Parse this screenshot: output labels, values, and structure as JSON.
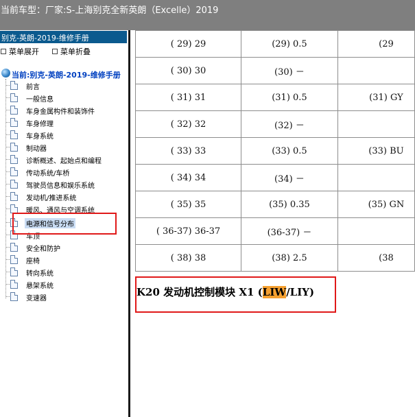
{
  "window": {
    "title": "当前车型：厂家:S-上海别克全新英朗（Excelle）2019"
  },
  "sidebar": {
    "header": "别克-英朗-2019-维修手册",
    "expand_label": "菜单展开",
    "collapse_label": "菜单折叠",
    "root_label": "当前:别克-英朗-2019-维修手册",
    "items": [
      {
        "label": "前言"
      },
      {
        "label": "一般信息"
      },
      {
        "label": "车身金属构件和装饰件"
      },
      {
        "label": "车身修理"
      },
      {
        "label": "车身系统"
      },
      {
        "label": "制动器"
      },
      {
        "label": "诊断概述、起始点和编程"
      },
      {
        "label": "传动系统/车桥"
      },
      {
        "label": "驾驶员信息和娱乐系统"
      },
      {
        "label": "发动机/推进系统"
      },
      {
        "label": "暖风、通风与空调系统"
      },
      {
        "label": "电源和信号分布"
      },
      {
        "label": "车顶"
      },
      {
        "label": "安全和防护"
      },
      {
        "label": "座椅"
      },
      {
        "label": "转向系统"
      },
      {
        "label": "悬架系统"
      },
      {
        "label": "变速器"
      }
    ]
  },
  "table": {
    "rows": [
      [
        "( 29) 29",
        "(29) 0.5",
        "(29"
      ],
      [
        "( 30) 30",
        "(30) －",
        ""
      ],
      [
        "( 31) 31",
        "(31) 0.5",
        "(31) GY"
      ],
      [
        "( 32) 32",
        "(32) －",
        ""
      ],
      [
        "( 33) 33",
        "(33) 0.5",
        "(33) BU"
      ],
      [
        "( 34) 34",
        "(34) －",
        ""
      ],
      [
        "( 35) 35",
        "(35) 0.35",
        "(35) GN"
      ],
      [
        "( 36-37) 36-37",
        "(36-37) －",
        ""
      ],
      [
        "( 38) 38",
        "(38) 2.5",
        "(38"
      ]
    ]
  },
  "heading": {
    "prefix": "K20 发动机控制模块 X1 (",
    "highlight": "LIW",
    "suffix": "/LIY)"
  },
  "colors": {
    "titlebar_bg": "#7f7f7f",
    "sidebar_header_bg": "#0b5a8e",
    "annotation_red": "#e01818",
    "search_highlight": "#f5a030",
    "selected_item_bg": "#c9dcf3"
  }
}
